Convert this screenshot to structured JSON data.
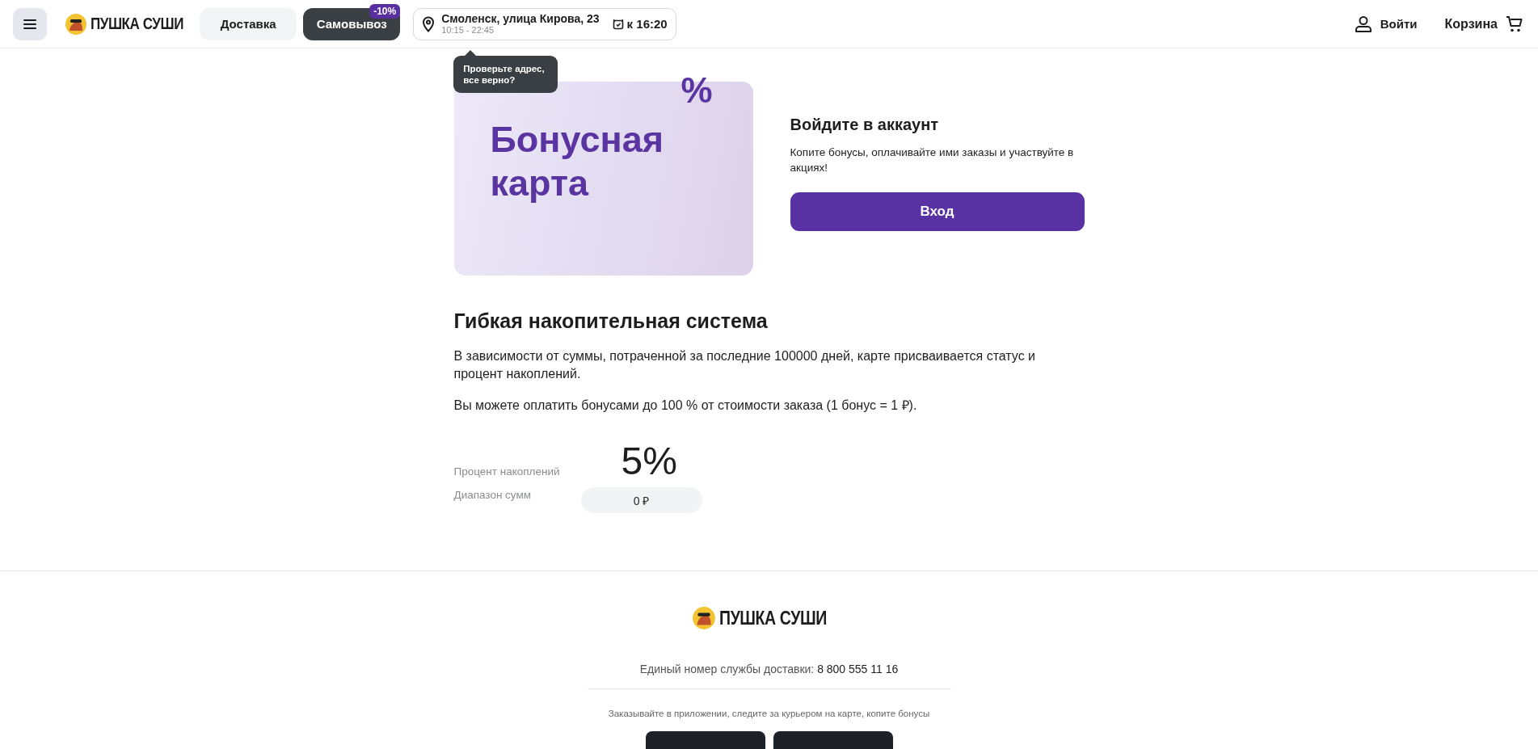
{
  "header": {
    "brand": "ПУШКА СУШИ",
    "tabs": [
      {
        "label": "Доставка",
        "selected": false
      },
      {
        "label": "Самовывоз",
        "selected": true,
        "badge": "-10%"
      }
    ],
    "address": {
      "street": "Смоленск, улица Кирова, 23",
      "hours": "10:15 - 22:45",
      "time": "к 16:20"
    },
    "tooltip": "Проверьте адрес, все верно?",
    "login": "Войти",
    "cart": "Корзина"
  },
  "bonus_card": {
    "title": "Бонусная карта",
    "symbol": "%"
  },
  "login_panel": {
    "title": "Войдите в аккаунт",
    "text": "Копите бонусы, оплачивайте ими заказы и участвуйте в акциях!",
    "button": "Вход"
  },
  "system": {
    "heading": "Гибкая накопительная система",
    "paragraphs": [
      "В зависимости от суммы, потраченной за последние 100000 дней, карте присваивается статус и процент накоплений.",
      "Вы можете оплатить бонусами до 100 % от стоимости заказа (1 бонус = 1 ₽)."
    ],
    "stats": [
      {
        "kind": "big",
        "label": "Процент накоплений",
        "value": "5%"
      },
      {
        "kind": "pill",
        "label": "Диапазон сумм",
        "value": "0 ₽"
      }
    ]
  },
  "footer": {
    "brand": "ПУШКА СУШИ",
    "phone_label": "Единый номер службы доставки:",
    "phone": "8 800 555 11 16",
    "app_text": "Заказывайте в приложении, следите за курьером на карте, копите бонусы"
  }
}
